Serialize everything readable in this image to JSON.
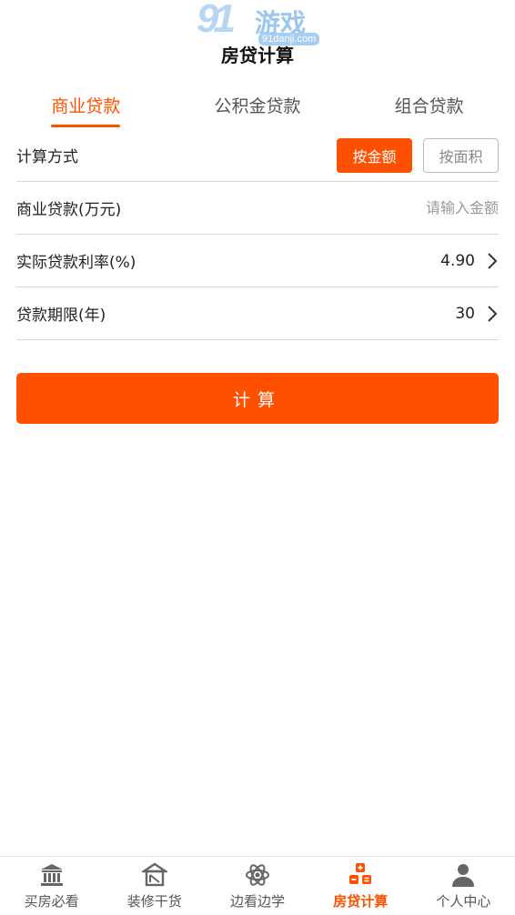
{
  "watermark": {
    "number": "91",
    "text": "游戏",
    "url": "91danji.com"
  },
  "header": {
    "title": "房贷计算"
  },
  "tabs": [
    {
      "label": "商业贷款",
      "active": true
    },
    {
      "label": "公积金贷款",
      "active": false
    },
    {
      "label": "组合贷款",
      "active": false
    }
  ],
  "form": {
    "method": {
      "label": "计算方式",
      "options": [
        "按金额",
        "按面积"
      ],
      "selected": "按金额"
    },
    "loan_amount": {
      "label": "商业贷款(万元)",
      "placeholder": "请输入金额",
      "value": ""
    },
    "rate": {
      "label": "实际贷款利率(%)",
      "value": "4.90"
    },
    "term": {
      "label": "贷款期限(年)",
      "value": "30"
    }
  },
  "calculate_button": {
    "label": "计算"
  },
  "bottom_nav": [
    {
      "label": "买房必看",
      "icon": "bank-icon",
      "active": false
    },
    {
      "label": "装修干货",
      "icon": "house-icon",
      "active": false
    },
    {
      "label": "边看边学",
      "icon": "atom-icon",
      "active": false
    },
    {
      "label": "房贷计算",
      "icon": "calculator-icon",
      "active": true
    },
    {
      "label": "个人中心",
      "icon": "user-icon",
      "active": false
    }
  ],
  "colors": {
    "accent": "#ff5000",
    "divider": "#d8d8d8",
    "nav_icon": "#666666"
  }
}
